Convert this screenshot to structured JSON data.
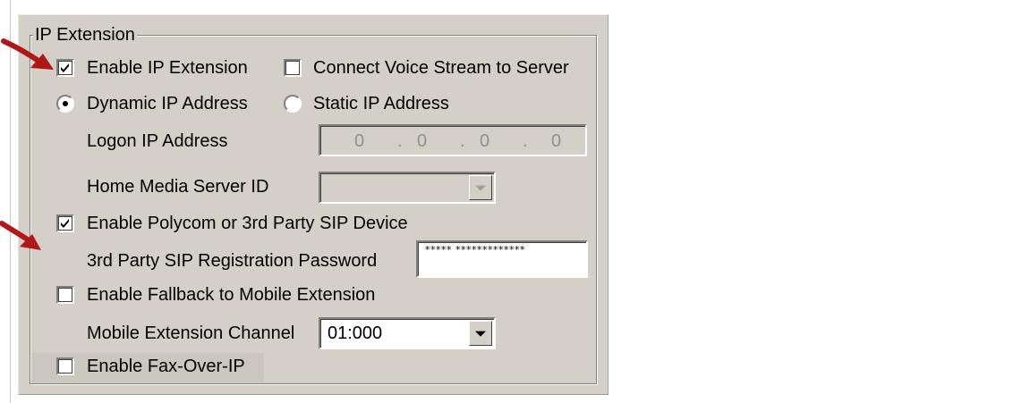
{
  "group": {
    "title": "IP Extension"
  },
  "enable_ip_extension": {
    "label": "Enable IP Extension",
    "checked": true
  },
  "connect_voice_stream": {
    "label": "Connect Voice Stream to Server",
    "checked": false
  },
  "dynamic_ip": {
    "label": "Dynamic IP Address",
    "selected": true
  },
  "static_ip": {
    "label": "Static IP Address",
    "selected": false
  },
  "logon_ip": {
    "label": "Logon IP Address",
    "octets": [
      "0",
      "0",
      "0",
      "0"
    ],
    "separators": [
      ".",
      ".",
      "."
    ],
    "enabled": false
  },
  "home_media_server": {
    "label": "Home Media Server ID",
    "value": "",
    "enabled": false
  },
  "enable_polycom": {
    "label": "Enable Polycom or 3rd Party SIP Device",
    "checked": true
  },
  "sip_password": {
    "label": "3rd Party SIP Registration Password",
    "value": "***** *************"
  },
  "enable_fallback": {
    "label": "Enable Fallback to Mobile Extension",
    "checked": false
  },
  "mobile_channel": {
    "label": "Mobile Extension Channel",
    "value": "01:000"
  },
  "enable_fax": {
    "label": "Enable Fax-Over-IP",
    "checked": false
  },
  "annotation": {
    "arrow_color": "#b01818"
  }
}
